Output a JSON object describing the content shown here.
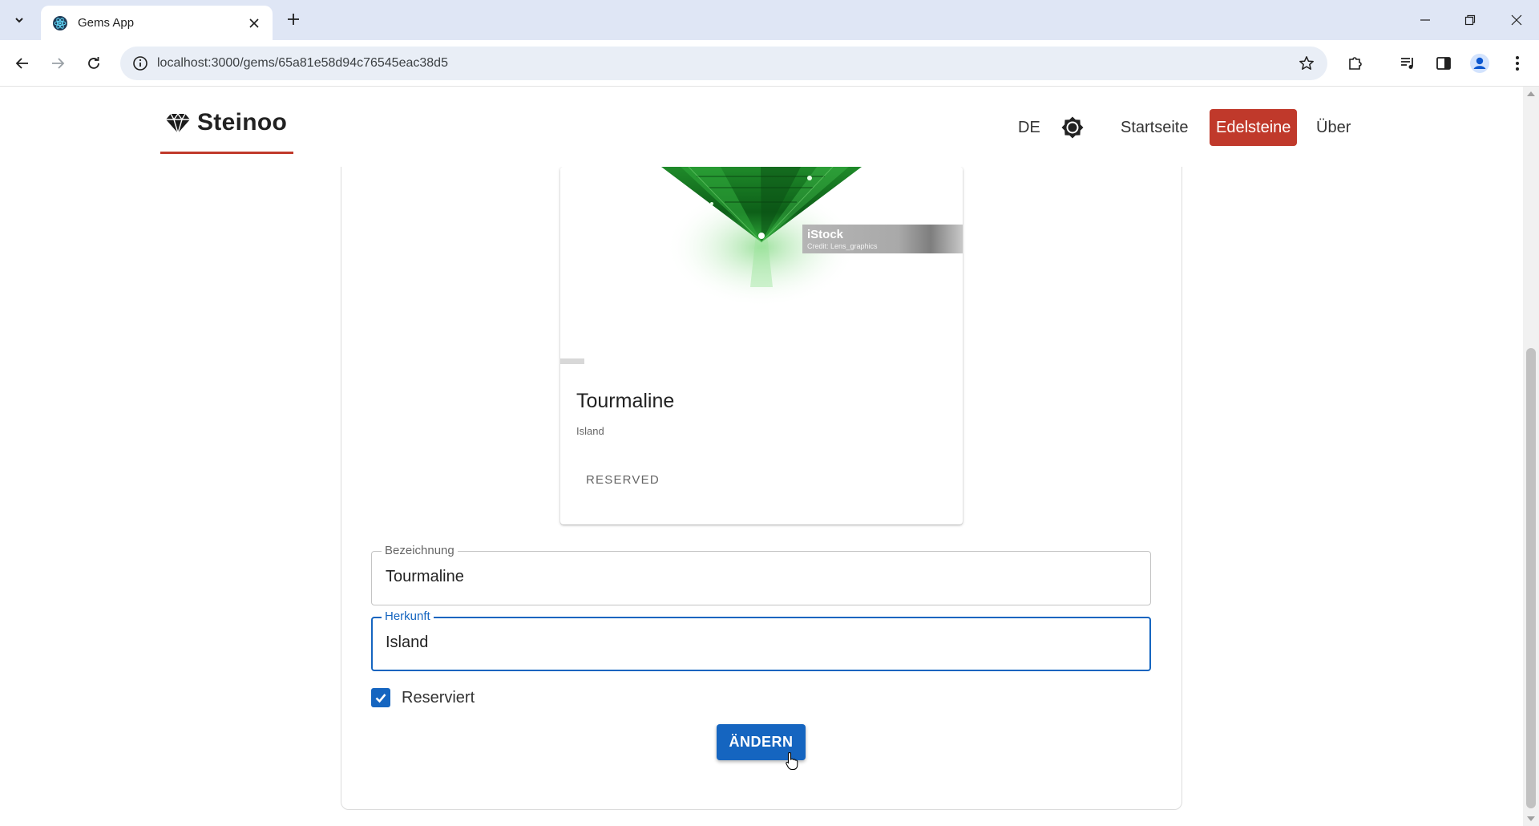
{
  "browser": {
    "tab_title": "Gems App",
    "url": "localhost:3000/gems/65a81e58d94c76545eac38d5"
  },
  "app": {
    "brand": "Steinoo",
    "language": "DE",
    "nav": {
      "home": "Startseite",
      "gems": "Edelsteine",
      "about": "Über"
    },
    "accent_color": "#c0392b",
    "primary_color": "#1565c0"
  },
  "gem_card": {
    "name": "Tourmaline",
    "origin": "Island",
    "status": "RESERVED",
    "image_watermark": "iStock",
    "image_credit": "Credit: Lens_graphics"
  },
  "form": {
    "name_label": "Bezeichnung",
    "name_value": "Tourmaline",
    "origin_label": "Herkunft",
    "origin_value": "Island",
    "reserved_label": "Reserviert",
    "reserved_checked": true,
    "submit_label": "ÄNDERN"
  }
}
